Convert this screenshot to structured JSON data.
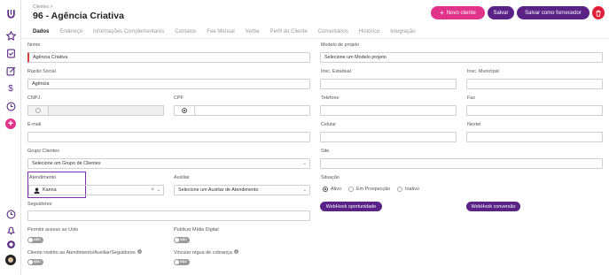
{
  "breadcrumb": {
    "parent": "Clientes",
    "separator": ">"
  },
  "page": {
    "title": "96 - Agência Criativa"
  },
  "actions": {
    "new_client": "Novo cliente",
    "save": "Salvar",
    "save_supplier": "Salvar como fornecedor"
  },
  "tabs": [
    "Dados",
    "Endereço",
    "Informações Complementares",
    "Contatos",
    "Fee Mensal",
    "Verba",
    "Perfil do Cliente",
    "Comentários",
    "Histórico",
    "Integração"
  ],
  "form": {
    "nome": {
      "label": "Nome",
      "value": "Agência Criativa"
    },
    "modelo": {
      "label": "Modelo de projeto",
      "value": "Selecione um Modelo projeto"
    },
    "razao": {
      "label": "Razão Social",
      "value": "Agência"
    },
    "insc_estadual": {
      "label": "Insc. Estadual",
      "value": ""
    },
    "insc_municipal": {
      "label": "Insc. Municipal",
      "value": ""
    },
    "cnpj": {
      "label": "CNPJ",
      "value": ""
    },
    "cpf": {
      "label": "CPF",
      "value": ""
    },
    "telefone": {
      "label": "Telefone",
      "value": ""
    },
    "fax": {
      "label": "Fax",
      "value": ""
    },
    "email": {
      "label": "E-mail",
      "value": ""
    },
    "celular": {
      "label": "Celular",
      "value": ""
    },
    "nextel": {
      "label": "Nextel",
      "value": ""
    },
    "grupo": {
      "label": "Grupo Clientes",
      "value": "Selecione um Grupo de Clientes"
    },
    "site": {
      "label": "Site",
      "value": ""
    },
    "atendimento": {
      "label": "Atendimento",
      "value": "Karina",
      "clear": "×"
    },
    "auxiliar": {
      "label": "Auxiliar",
      "value": "Selecione um Auxiliar de Atendimento"
    },
    "situacao": {
      "label": "Situação",
      "options": [
        "Ativo",
        "Em Prospecção",
        "Inativo"
      ],
      "selected": "Ativo"
    },
    "seguidores": {
      "label": "Seguidores",
      "value": ""
    },
    "acesso": {
      "label": "Permitir acesso ao Uolo",
      "toggle": "NÃO"
    },
    "midia": {
      "label": "Publicar Mídia Digital",
      "toggle": "NÃO"
    },
    "restrito": {
      "label": "Cliente restrito ao Atendimento/Auxiliar/Seguidores",
      "toggle": "NÃO"
    },
    "regua": {
      "label": "Vincular régua de cobrança",
      "toggle": "NÃO"
    }
  },
  "webhooks": {
    "oportunidade": "WebHook oportunidade",
    "conversao": "WebHook conversão"
  },
  "colors": {
    "accent": "#5a2286",
    "pink": "#e2338a",
    "danger": "#e0203a"
  },
  "icons": {
    "rail": [
      "logo-icon",
      "star-icon",
      "checklist-icon",
      "edit-icon",
      "dollar-icon",
      "clock-icon",
      "plus-icon",
      "clock-icon",
      "bell-icon",
      "target-icon",
      "avatar"
    ]
  }
}
